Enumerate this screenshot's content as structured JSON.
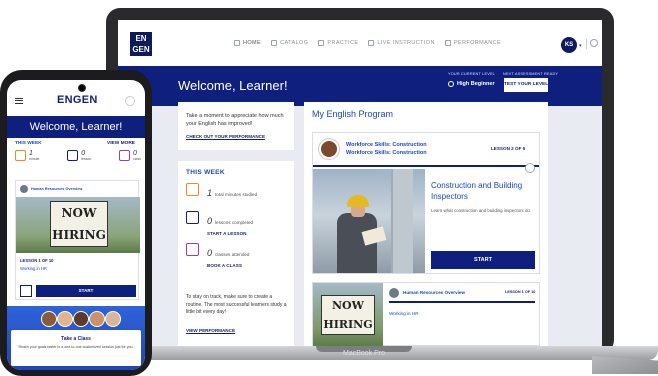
{
  "laptop": {
    "label": "MacBook Pro",
    "logo": "EN GEN",
    "nav": {
      "items": [
        {
          "label": "HOME",
          "icon": "home-icon",
          "active": true
        },
        {
          "label": "CATALOG",
          "icon": "catalog-icon",
          "active": false
        },
        {
          "label": "PRACTICE",
          "icon": "practice-icon",
          "active": false
        },
        {
          "label": "LIVE INSTRUCTION",
          "icon": "live-instruction-icon",
          "active": false
        },
        {
          "label": "PERFORMANCE",
          "icon": "performance-icon",
          "active": false
        }
      ],
      "avatar_initials": "KS"
    },
    "banner": {
      "welcome": "Welcome, Learner!",
      "current_level_label": "YOUR CURRENT LEVEL",
      "current_level_value": "High Beginner",
      "assessment_label": "NEXT ASSESSMENT READY",
      "test_button": "TEST YOUR LEVEL"
    },
    "intro_card": {
      "text": "Take a moment to appreciate how much your English has improved!",
      "link": "CHECK OUT YOUR PERFORMANCE"
    },
    "this_week": {
      "title": "THIS WEEK",
      "stats": [
        {
          "value": "1",
          "label": "total minutes studied",
          "action": ""
        },
        {
          "value": "0",
          "label": "lessons completed",
          "action": "START A LESSON"
        },
        {
          "value": "0",
          "label": "classes attended",
          "action": "BOOK A CLASS"
        }
      ],
      "note": "To stay on track, make sure to create a routine. The most successful learners study a little bit every day!",
      "link": "VIEW PERFORMANCE"
    },
    "program": {
      "title": "My English Program",
      "course_line1": "Workforce Skills: Construction",
      "course_line2": "Workforce Skills: Construction",
      "lesson_badge": "LESSON 2 OF 5",
      "lesson_name": "Construction and Building Inspectors",
      "lesson_desc": "Learn what construction and building inspectors do.",
      "start": "START",
      "next_course": "Human Resources Overview",
      "next_lesson_badge": "LESSON 1 OF 10",
      "next_lesson_name": "Working in HR",
      "sign_text": "NOW HIRING"
    }
  },
  "phone": {
    "logo": "ENGEN",
    "welcome": "Welcome, Learner!",
    "this_week": "THIS WEEK",
    "view_more": "VIEW MORE",
    "stats": [
      {
        "value": "1",
        "label": "minute"
      },
      {
        "value": "0",
        "label": "lesson"
      },
      {
        "value": "0",
        "label": "class"
      }
    ],
    "card": {
      "course": "Human Resources Overview",
      "sign_text": "NOW HIRING",
      "lesson": "LESSON 1 OF 10",
      "name": "Working in HR",
      "start": "START"
    },
    "class_section": {
      "title": "Take a Class",
      "text": "Reach your goals faster in a one-to-one customized session just for you."
    }
  }
}
